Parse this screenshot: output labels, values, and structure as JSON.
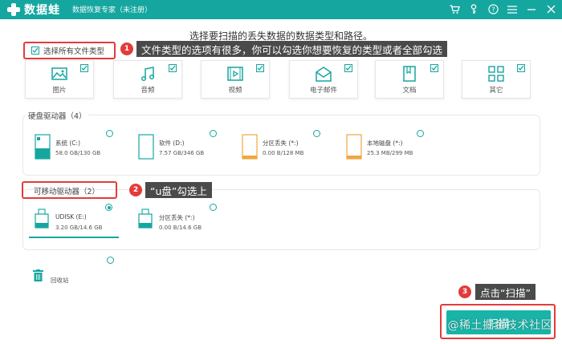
{
  "app": {
    "logo_text": "数据蛙",
    "subtitle": "数据恢复专家（未注册）"
  },
  "headline": "选择要扫描的丢失数据的数据类型和路径。",
  "select_all": {
    "label": "选择所有文件类型",
    "checked": true
  },
  "annotations": {
    "a1": {
      "num": "1",
      "text": "文件类型的选项有很多，你可以勾选你想要恢复的类型或者全部勾选"
    },
    "a2": {
      "num": "2",
      "text": "“u盘”勾选上"
    },
    "a3": {
      "num": "3",
      "text": "点击“扫描”"
    }
  },
  "file_types": [
    {
      "label": "图片",
      "icon": "image-icon",
      "checked": true
    },
    {
      "label": "音频",
      "icon": "music-icon",
      "checked": true
    },
    {
      "label": "视频",
      "icon": "video-icon",
      "checked": true
    },
    {
      "label": "电子邮件",
      "icon": "email-icon",
      "checked": true
    },
    {
      "label": "文档",
      "icon": "document-icon",
      "checked": true
    },
    {
      "label": "其它",
      "icon": "other-icon",
      "checked": true
    }
  ],
  "hard_drives": {
    "title": "硬盘驱动器（4）",
    "items": [
      {
        "name": "系统 (C:)",
        "size": "58.0 GB/130 GB",
        "icon": "system-drive-icon"
      },
      {
        "name": "软件 (D:)",
        "size": "7.57 GB/346 GB",
        "icon": "drive-icon"
      },
      {
        "name": "分区丢失 (*:)",
        "size": "0.00  B/128 MB",
        "icon": "lost-partition-icon"
      },
      {
        "name": "本地磁盘 (*:)",
        "size": "25.3 MB/299 MB",
        "icon": "local-disk-icon"
      }
    ]
  },
  "removable_drives": {
    "title": "可移动驱动器（2）",
    "items": [
      {
        "name": "UDISK (E:)",
        "size": "3.20 GB/14.6 GB",
        "icon": "usb-drive-icon",
        "selected": true
      },
      {
        "name": "分区丢失 (*:)",
        "size": "0.00  B/14.6 GB",
        "icon": "usb-drive-icon",
        "selected": false
      }
    ]
  },
  "recycle_bin": {
    "label": "回收站",
    "icon": "trash-icon"
  },
  "scan_button": {
    "label": "扫描"
  },
  "watermark": "@稀土掘金技术社区",
  "colors": {
    "accent": "#16a6a0",
    "highlight": "#e33b3b",
    "annotation_bg": "#4a4a4a"
  }
}
